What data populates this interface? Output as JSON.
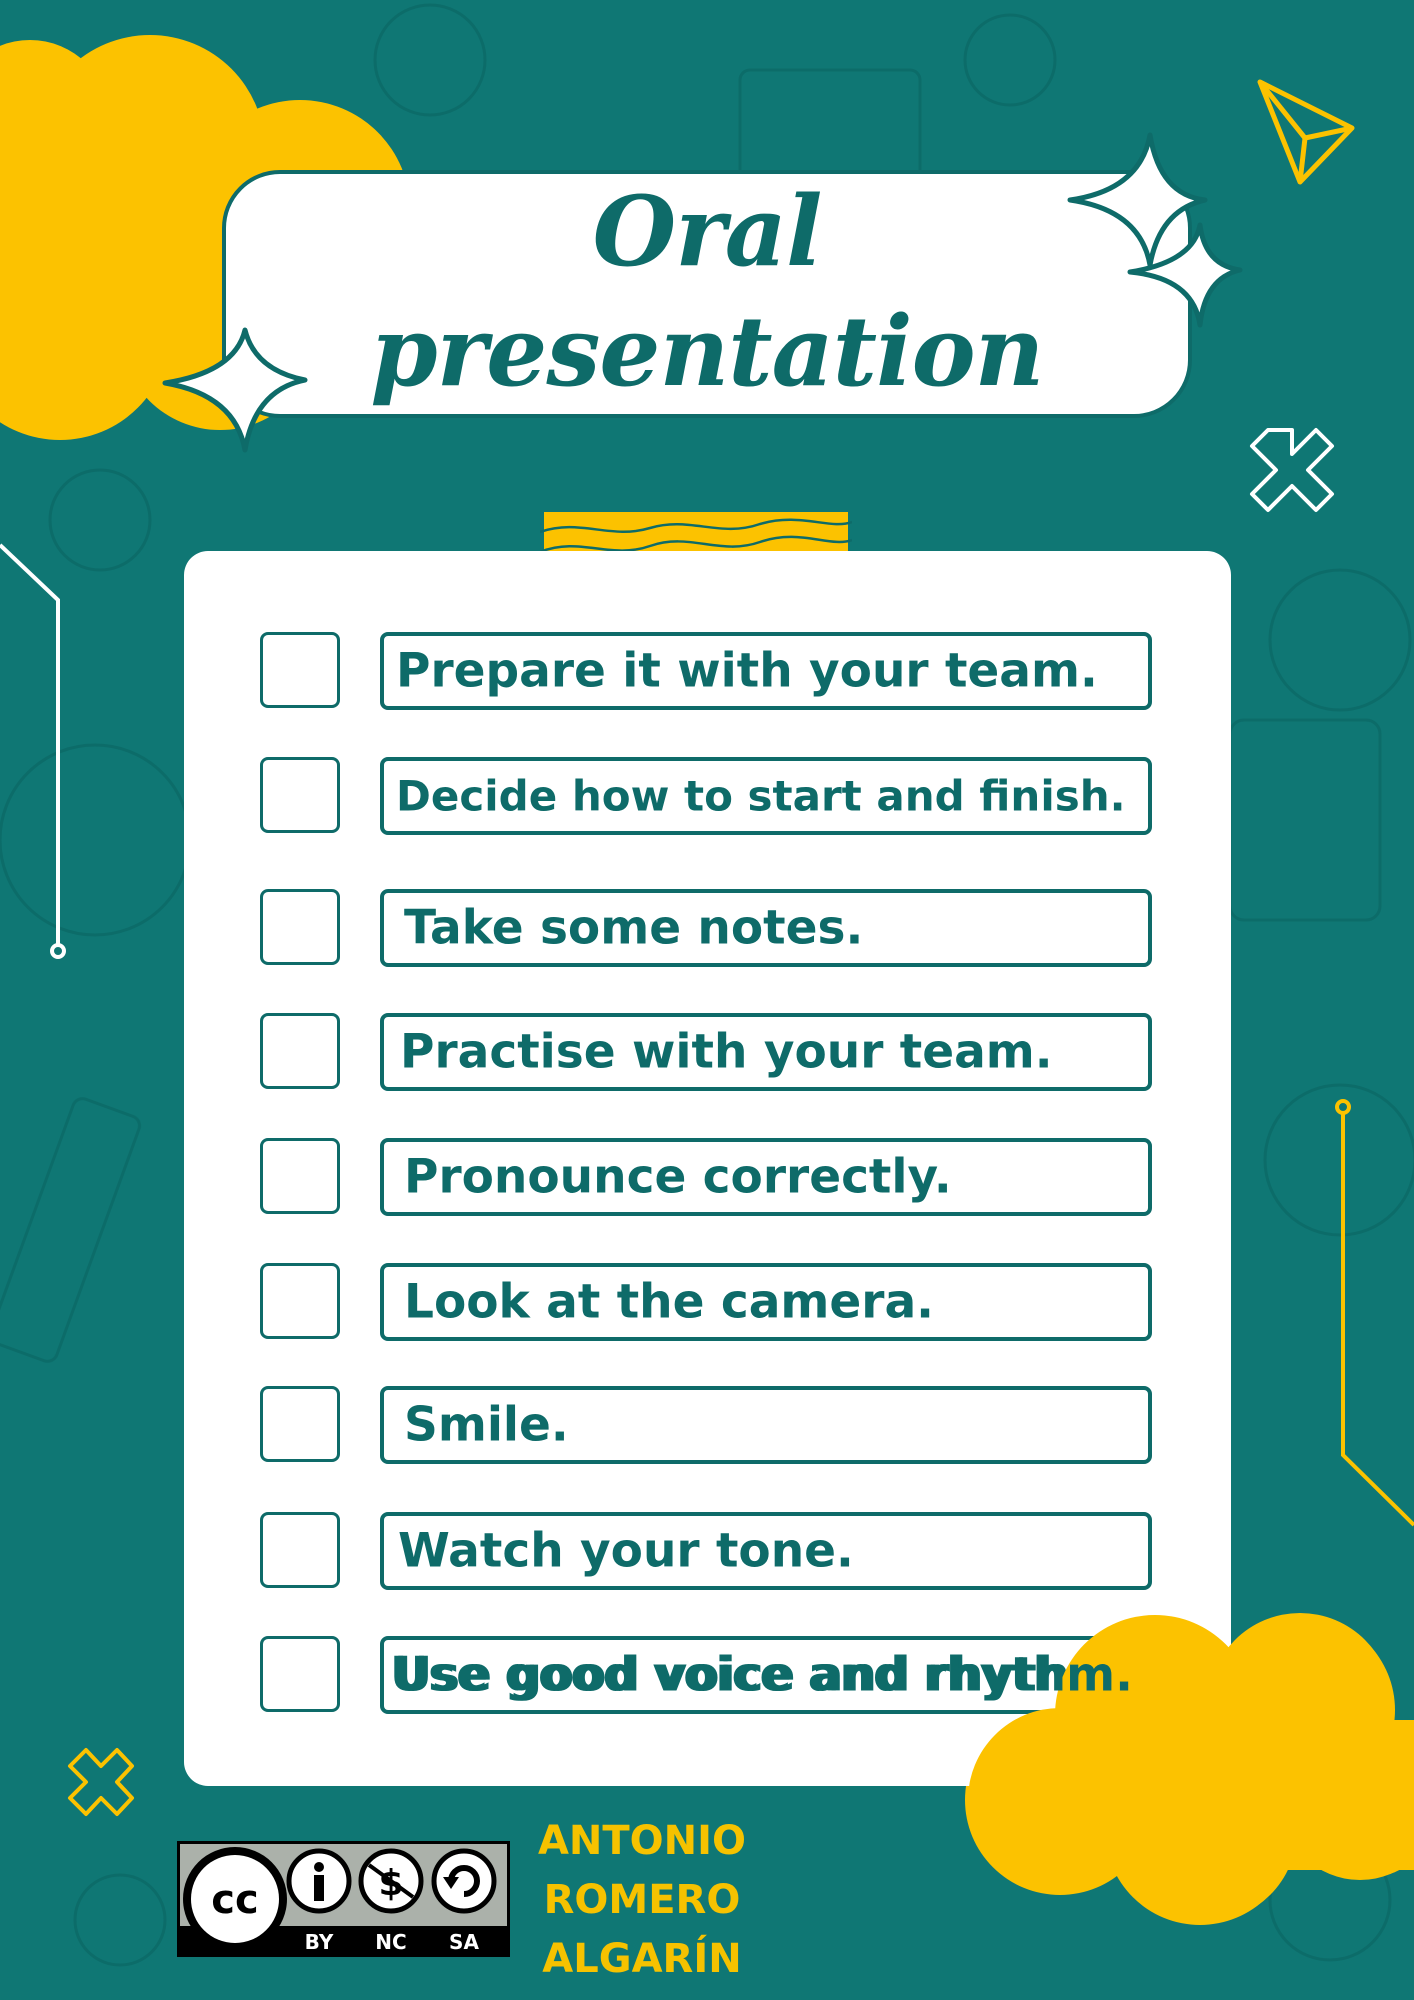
{
  "title": {
    "line1": "Oral",
    "line2": "presentation"
  },
  "checklist": [
    "Prepare it with your team.",
    "Decide how to start and finish.",
    "Take some notes.",
    "Practise with your team.",
    "Pronounce correctly.",
    "Look at the camera.",
    "Smile.",
    "Watch your tone.",
    "Use good voice and rhythm."
  ],
  "license": {
    "badge_icons": [
      "cc-icon",
      "by-person-icon",
      "nc-no-dollar-icon",
      "sa-share-alike-icon"
    ],
    "labels": [
      "BY",
      "NC",
      "SA"
    ]
  },
  "author": {
    "line1": "ANTONIO",
    "line2": "ROMERO",
    "line3": "ALGARÍN"
  },
  "colors": {
    "background": "#0f7774",
    "accent_yellow": "#fcc200",
    "text_teal": "#0e6b69",
    "card": "#ffffff"
  }
}
